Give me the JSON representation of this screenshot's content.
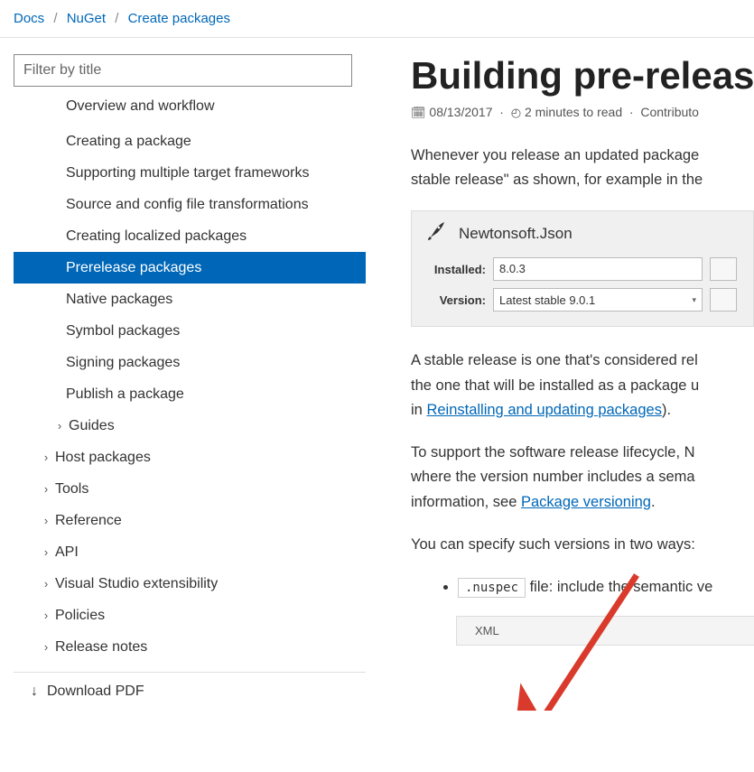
{
  "breadcrumb": {
    "b0": "Docs",
    "b1": "NuGet",
    "b2": "Create packages"
  },
  "sidebar": {
    "filter_placeholder": "Filter by title",
    "items": [
      {
        "label": "Overview and workflow"
      },
      {
        "label": "Creating a package"
      },
      {
        "label": "Supporting multiple target frameworks"
      },
      {
        "label": "Source and config file transformations"
      },
      {
        "label": "Creating localized packages"
      },
      {
        "label": "Prerelease packages"
      },
      {
        "label": "Native packages"
      },
      {
        "label": "Symbol packages"
      },
      {
        "label": "Signing packages"
      },
      {
        "label": "Publish a package"
      },
      {
        "label": "Guides"
      }
    ],
    "top_items": [
      {
        "label": "Host packages"
      },
      {
        "label": "Tools"
      },
      {
        "label": "Reference"
      },
      {
        "label": "API"
      },
      {
        "label": "Visual Studio extensibility"
      },
      {
        "label": "Policies"
      },
      {
        "label": "Release notes"
      }
    ],
    "download": "Download PDF"
  },
  "article": {
    "title": "Building pre-release",
    "date": "08/13/2017",
    "read_time": "2 minutes to read",
    "contributors": "Contributo",
    "p1": "Whenever you release an updated package",
    "p2": "stable release\" as shown, for example in the",
    "infobox": {
      "title": "Newtonsoft.Json",
      "installed_label": "Installed:",
      "installed_value": "8.0.3",
      "version_label": "Version:",
      "version_value": "Latest stable 9.0.1"
    },
    "p3a": "A stable release is one that's considered rel",
    "p3b": "the one that will be installed as a package u",
    "p3c_prefix": "in ",
    "p3c_link": "Reinstalling and updating packages",
    "p3c_suffix": ").",
    "p4a": "To support the software release lifecycle, N",
    "p4b": "where the version number includes a sema",
    "p4c_prefix": "information, see ",
    "p4c_link": "Package versioning",
    "p4c_suffix": ".",
    "p5": "You can specify such versions in two ways:",
    "bullet1_code": ".nuspec",
    "bullet1_text": " file: include the semantic ve",
    "code_header": "XML"
  }
}
